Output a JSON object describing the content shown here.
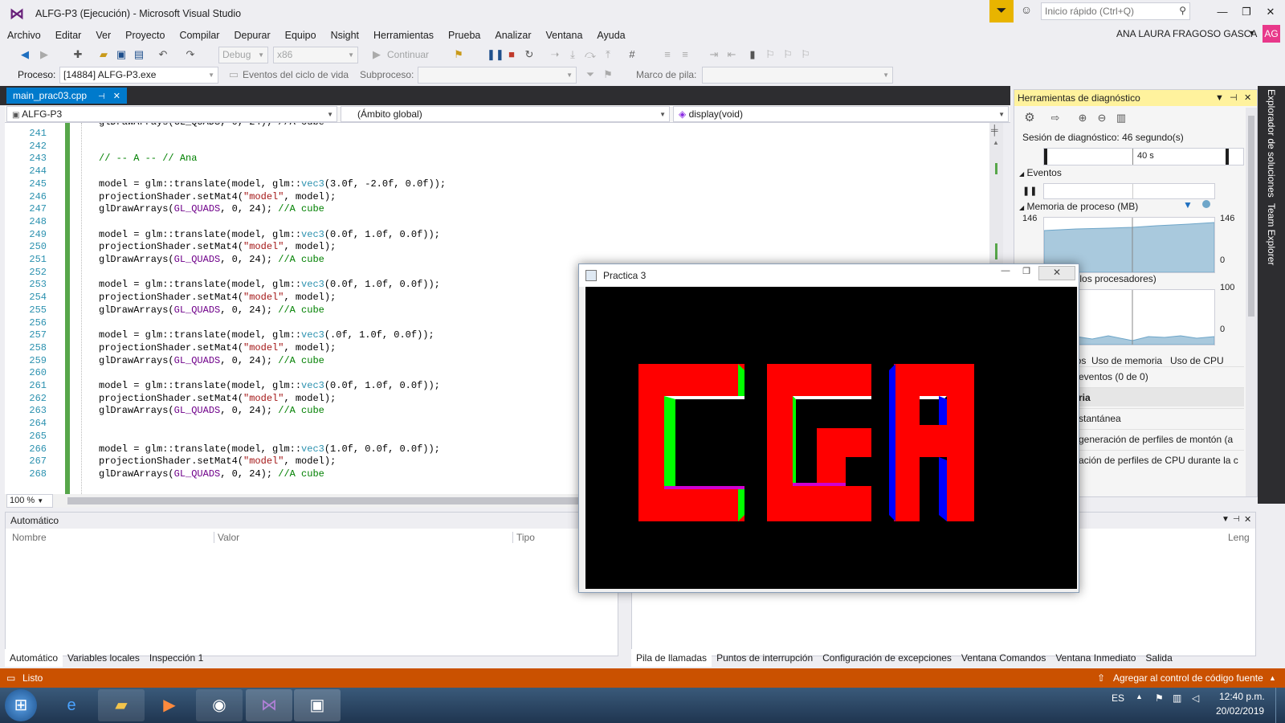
{
  "window": {
    "title": "ALFG-P3 (Ejecución) - Microsoft Visual Studio",
    "quick_launch_placeholder": "Inicio rápido (Ctrl+Q)",
    "user_name": "ANA LAURA FRAGOSO GASCA",
    "user_initials": "AG",
    "minimize": "—",
    "maximize": "❐",
    "close": "✕"
  },
  "menu": [
    "Archivo",
    "Editar",
    "Ver",
    "Proyecto",
    "Compilar",
    "Depurar",
    "Equipo",
    "Nsight",
    "Herramientas",
    "Prueba",
    "Analizar",
    "Ventana",
    "Ayuda"
  ],
  "toolbar": {
    "config": "Debug",
    "platform": "x86",
    "continue_label": "Continuar",
    "process_label": "Proceso:",
    "process_value": "[14884] ALFG-P3.exe",
    "lifecycle_label": "Eventos del ciclo de vida",
    "thread_label": "Subproceso:",
    "stackframe_label": "Marco de pila:"
  },
  "editor": {
    "tab": "main_prac03.cpp",
    "nav_project": "ALFG-P3",
    "nav_scope": "(Ámbito global)",
    "nav_function": "display(void)",
    "zoom": "100 %",
    "lines": [
      {
        "n": "241",
        "text": ""
      },
      {
        "n": "242",
        "text": ""
      },
      {
        "n": "243",
        "text": "// -- A -- // Ana",
        "kind": "comment"
      },
      {
        "n": "244",
        "text": ""
      },
      {
        "n": "245",
        "pre": "model = glm::translate(model, glm::",
        "kw": "vec3",
        "post": "(3.0f, -2.0f, 0.0f));"
      },
      {
        "n": "246",
        "pre": "projectionShader.setMat4(",
        "str": "\"model\"",
        "post": ", model);"
      },
      {
        "n": "247",
        "pre": "glDrawArrays(",
        "mac": "GL_QUADS",
        "post": ", 0, 24); ",
        "cmt": "//A cube"
      },
      {
        "n": "248",
        "text": ""
      },
      {
        "n": "249",
        "pre": "model = glm::translate(model, glm::",
        "kw": "vec3",
        "post": "(0.0f, 1.0f, 0.0f));"
      },
      {
        "n": "250",
        "pre": "projectionShader.setMat4(",
        "str": "\"model\"",
        "post": ", model);"
      },
      {
        "n": "251",
        "pre": "glDrawArrays(",
        "mac": "GL_QUADS",
        "post": ", 0, 24); ",
        "cmt": "//A cube"
      },
      {
        "n": "252",
        "text": ""
      },
      {
        "n": "253",
        "pre": "model = glm::translate(model, glm::",
        "kw": "vec3",
        "post": "(0.0f, 1.0f, 0.0f));"
      },
      {
        "n": "254",
        "pre": "projectionShader.setMat4(",
        "str": "\"model\"",
        "post": ", model);"
      },
      {
        "n": "255",
        "pre": "glDrawArrays(",
        "mac": "GL_QUADS",
        "post": ", 0, 24); ",
        "cmt": "//A cube"
      },
      {
        "n": "256",
        "text": ""
      },
      {
        "n": "257",
        "pre": "model = glm::translate(model, glm::",
        "kw": "vec3",
        "post": "(.0f, 1.0f, 0.0f));"
      },
      {
        "n": "258",
        "pre": "projectionShader.setMat4(",
        "str": "\"model\"",
        "post": ", model);"
      },
      {
        "n": "259",
        "pre": "glDrawArrays(",
        "mac": "GL_QUADS",
        "post": ", 0, 24); ",
        "cmt": "//A cube"
      },
      {
        "n": "260",
        "text": ""
      },
      {
        "n": "261",
        "pre": "model = glm::translate(model, glm::",
        "kw": "vec3",
        "post": "(0.0f, 1.0f, 0.0f));"
      },
      {
        "n": "262",
        "pre": "projectionShader.setMat4(",
        "str": "\"model\"",
        "post": ", model);"
      },
      {
        "n": "263",
        "pre": "glDrawArrays(",
        "mac": "GL_QUADS",
        "post": ", 0, 24); ",
        "cmt": "//A cube"
      },
      {
        "n": "264",
        "text": ""
      },
      {
        "n": "265",
        "text": ""
      },
      {
        "n": "266",
        "pre": "model = glm::translate(model, glm::",
        "kw": "vec3",
        "post": "(1.0f, 0.0f, 0.0f));"
      },
      {
        "n": "267",
        "pre": "projectionShader.setMat4(",
        "str": "\"model\"",
        "post": ", model);"
      },
      {
        "n": "268",
        "pre": "glDrawArrays(",
        "mac": "GL_QUADS",
        "post": ", 0, 24); ",
        "cmt": "//A cube"
      }
    ]
  },
  "diagnostics": {
    "title": "Herramientas de diagnóstico",
    "session": "Sesión de diagnóstico: 46 segundo(s)",
    "timeline_label": "40 s",
    "events_label": "Eventos",
    "memory_label": "Memoria de proceso (MB)",
    "mem_max_left": "146",
    "mem_max_right": "146",
    "mem_min_left": "0",
    "mem_min_right": "0",
    "cpu_label": "odos los procesadores)",
    "cpu_max": "100",
    "cpu_min": "0",
    "tabs": [
      "entos",
      "Uso de memoria",
      "Uso de CPU"
    ],
    "rows": [
      "eventos (0 de 0)",
      "ria",
      "stantánea",
      "generación de perfiles de montón (a",
      "ación de perfiles de CPU durante la c"
    ]
  },
  "side_tabs": [
    "Explorador de soluciones",
    "Team Explorer"
  ],
  "auto_panel": {
    "title": "Automático",
    "columns": [
      "Nombre",
      "Valor",
      "Tipo"
    ],
    "tabs": [
      "Automático",
      "Variables locales",
      "Inspección 1"
    ]
  },
  "right_panel": {
    "column_partial": "Leng",
    "tabs": [
      "Pila de llamadas",
      "Puntos de interrupción",
      "Configuración de excepciones",
      "Ventana Comandos",
      "Ventana Inmediato",
      "Salida"
    ]
  },
  "status": {
    "left": "Listo",
    "right": "Agregar al control de código fuente"
  },
  "taskbar": {
    "lang": "ES",
    "time": "12:40 p.m.",
    "date": "20/02/2019"
  },
  "gl_window": {
    "title": "Practica 3",
    "minimize": "—",
    "maximize": "❐",
    "close": "✕",
    "colors": {
      "face": "#ff0000",
      "side_c": "#00ff00",
      "side_a": "#0000ff",
      "bevel": "#d000d0",
      "top": "#ffffff"
    }
  }
}
